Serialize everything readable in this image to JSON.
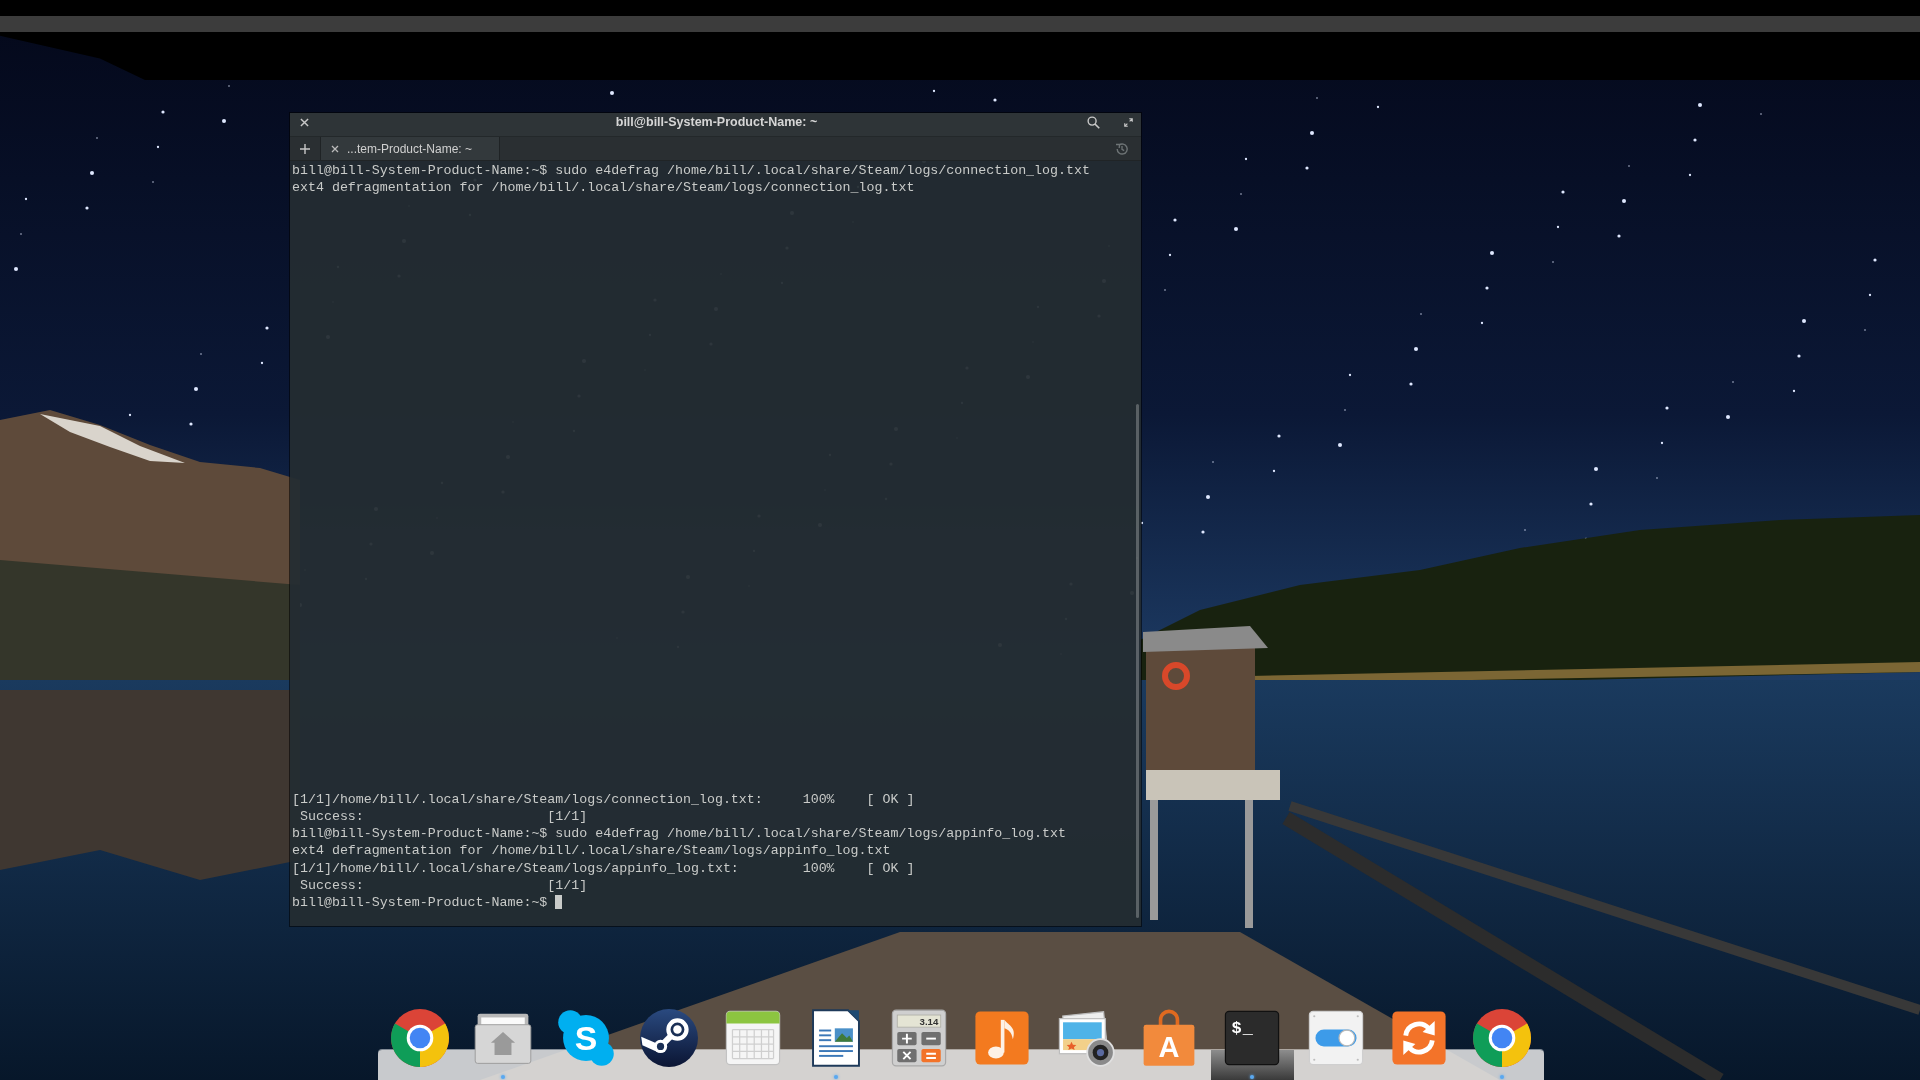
{
  "terminal": {
    "title": "bill@bill-System-Product-Name: ~",
    "tabs": [
      {
        "label": "...tem-Product-Name: ~",
        "selected": true
      }
    ],
    "lines_top": [
      "bill@bill-System-Product-Name:~$ sudo e4defrag /home/bill/.local/share/Steam/logs/connection_log.txt",
      "ext4 defragmentation for /home/bill/.local/share/Steam/logs/connection_log.txt"
    ],
    "lines_bottom": [
      "[1/1]/home/bill/.local/share/Steam/logs/connection_log.txt:     100%    [ OK ]",
      " Success:                       [1/1]",
      "bill@bill-System-Product-Name:~$ sudo e4defrag /home/bill/.local/share/Steam/logs/appinfo_log.txt",
      "ext4 defragmentation for /home/bill/.local/share/Steam/logs/appinfo_log.txt",
      "[1/1]/home/bill/.local/share/Steam/logs/appinfo_log.txt:        100%    [ OK ]",
      " Success:                       [1/1]"
    ],
    "prompt": "bill@bill-System-Product-Name:~$"
  },
  "dock": {
    "items": [
      {
        "kind": "browser",
        "running": false,
        "active": false
      },
      {
        "kind": "home-folder",
        "running": true,
        "active": false
      },
      {
        "kind": "chat",
        "glyph": "S",
        "running": false,
        "active": false
      },
      {
        "kind": "piston",
        "running": false,
        "active": false
      },
      {
        "kind": "calendar",
        "running": false,
        "active": false
      },
      {
        "kind": "document",
        "running": true,
        "active": false
      },
      {
        "kind": "calculator",
        "glyph": "3.14",
        "running": false,
        "active": false
      },
      {
        "kind": "music",
        "running": false,
        "active": false
      },
      {
        "kind": "photos",
        "running": false,
        "active": false
      },
      {
        "kind": "bag",
        "glyph": "A",
        "running": false,
        "active": false
      },
      {
        "kind": "terminal",
        "glyph": "$_",
        "running": true,
        "active": true
      },
      {
        "kind": "toggle",
        "running": false,
        "active": false
      },
      {
        "kind": "sync",
        "running": false,
        "active": false
      },
      {
        "kind": "browser",
        "running": true,
        "active": false
      }
    ]
  }
}
